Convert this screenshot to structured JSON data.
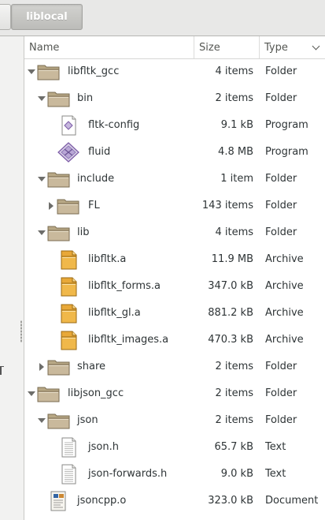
{
  "window": {
    "path_prev_label": "",
    "path_current": "liblocal"
  },
  "columns": {
    "name": "Name",
    "size": "Size",
    "type": "Type",
    "sort_indicator_icon": "chevron-down-icon"
  },
  "colors": {
    "folder_icon": "#c9b99c",
    "archive_icon": "#e8a838",
    "program_icon": "#7b5aa6"
  },
  "rows": [
    {
      "name": "libfltk_gcc",
      "size": "4 items",
      "type": "Folder",
      "icon": "folder-icon",
      "depth": 0,
      "expander": "open"
    },
    {
      "name": "bin",
      "size": "2 items",
      "type": "Folder",
      "icon": "folder-icon",
      "depth": 1,
      "expander": "open"
    },
    {
      "name": "fltk-config",
      "size": "9.1 kB",
      "type": "Program",
      "icon": "script-file-icon",
      "depth": 2,
      "expander": "none"
    },
    {
      "name": "fluid",
      "size": "4.8 MB",
      "type": "Program",
      "icon": "executable-icon",
      "depth": 2,
      "expander": "none"
    },
    {
      "name": "include",
      "size": "1 item",
      "type": "Folder",
      "icon": "folder-icon",
      "depth": 1,
      "expander": "open"
    },
    {
      "name": "FL",
      "size": "143 items",
      "type": "Folder",
      "icon": "folder-icon",
      "depth": 2,
      "expander": "closed"
    },
    {
      "name": "lib",
      "size": "4 items",
      "type": "Folder",
      "icon": "folder-icon",
      "depth": 1,
      "expander": "open"
    },
    {
      "name": "libfltk.a",
      "size": "11.9 MB",
      "type": "Archive",
      "icon": "archive-icon",
      "depth": 2,
      "expander": "none"
    },
    {
      "name": "libfltk_forms.a",
      "size": "347.0 kB",
      "type": "Archive",
      "icon": "archive-icon",
      "depth": 2,
      "expander": "none"
    },
    {
      "name": "libfltk_gl.a",
      "size": "881.2 kB",
      "type": "Archive",
      "icon": "archive-icon",
      "depth": 2,
      "expander": "none"
    },
    {
      "name": "libfltk_images.a",
      "size": "470.3 kB",
      "type": "Archive",
      "icon": "archive-icon",
      "depth": 2,
      "expander": "none"
    },
    {
      "name": "share",
      "size": "2 items",
      "type": "Folder",
      "icon": "folder-icon",
      "depth": 1,
      "expander": "closed"
    },
    {
      "name": "libjson_gcc",
      "size": "2 items",
      "type": "Folder",
      "icon": "folder-icon",
      "depth": 0,
      "expander": "open"
    },
    {
      "name": "json",
      "size": "2 items",
      "type": "Folder",
      "icon": "folder-icon",
      "depth": 1,
      "expander": "open"
    },
    {
      "name": "json.h",
      "size": "65.7 kB",
      "type": "Text",
      "icon": "text-file-icon",
      "depth": 2,
      "expander": "none"
    },
    {
      "name": "json-forwards.h",
      "size": "9.0 kB",
      "type": "Text",
      "icon": "text-file-icon",
      "depth": 2,
      "expander": "none"
    },
    {
      "name": "jsoncpp.o",
      "size": "323.0 kB",
      "type": "Document",
      "icon": "document-icon",
      "depth": 1,
      "expander": "none"
    }
  ]
}
